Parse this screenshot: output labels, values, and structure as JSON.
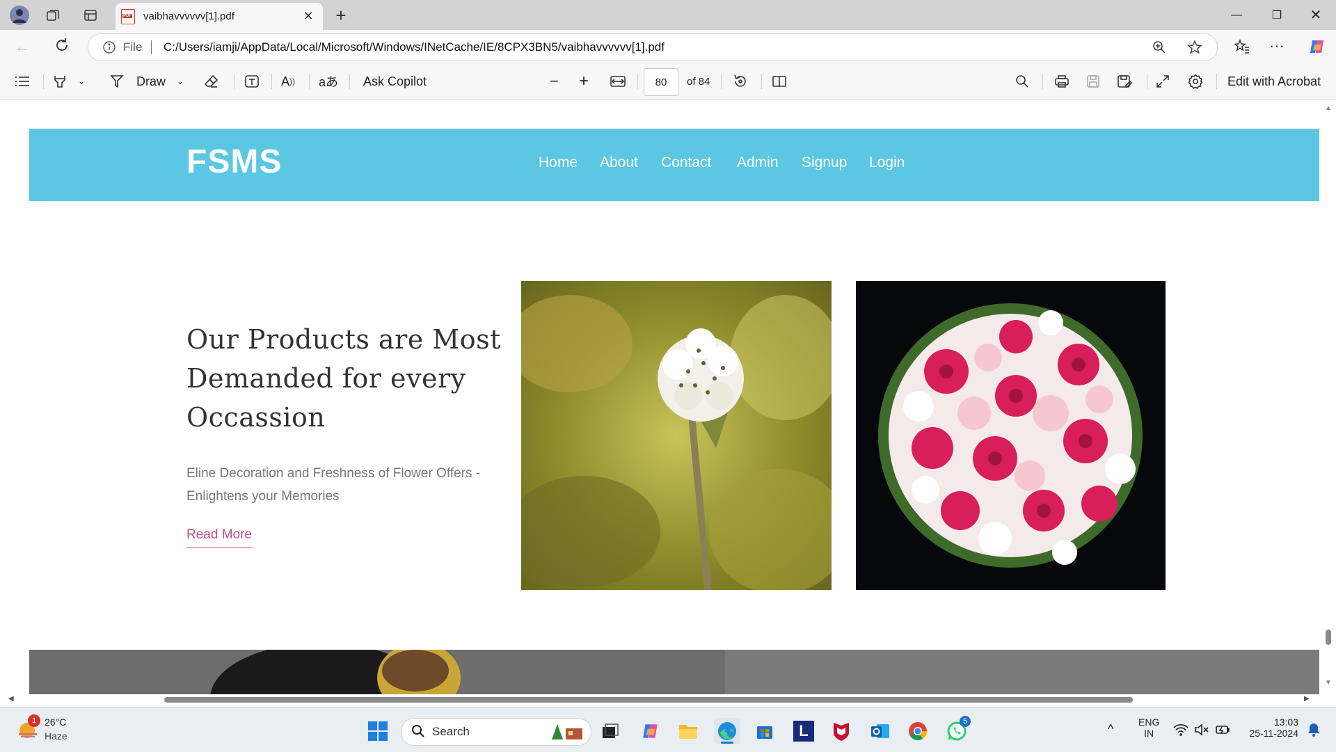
{
  "browser": {
    "tab_title": "vaibhavvvvvv[1].pdf",
    "new_tab": "+",
    "url_prefix": "File",
    "url": "C:/Users/iamji/AppData/Local/Microsoft/Windows/INetCache/IE/8CPX3BN5/vaibhavvvvvv[1].pdf",
    "window_controls": [
      "minimize",
      "restore",
      "close"
    ]
  },
  "pdf_toolbar": {
    "draw_label": "Draw",
    "ask_copilot_label": "Ask Copilot",
    "page_current": "80",
    "page_total": "of 84",
    "edit_acrobat_label": "Edit with Acrobat"
  },
  "page": {
    "logo": "FSMS",
    "nav": [
      "Home",
      "About",
      "Contact",
      "Admin",
      "Signup",
      "Login"
    ],
    "headline": "Our Products are Most Demanded for every Occassion",
    "subtext": "Eline Decoration and Freshness of Flower Offers - Enlightens your Memories",
    "read_more": "Read More",
    "colors": {
      "navbar": "#5bc7e2",
      "read_more": "#c54c88"
    }
  },
  "taskbar": {
    "weather_temp": "26°C",
    "weather_desc": "Haze",
    "weather_badge": "1",
    "search_placeholder": "Search",
    "lang_1": "ENG",
    "lang_2": "IN",
    "time": "13:03",
    "date": "25-11-2024",
    "whatsapp_badge": "5",
    "l_app_letter": "L"
  }
}
